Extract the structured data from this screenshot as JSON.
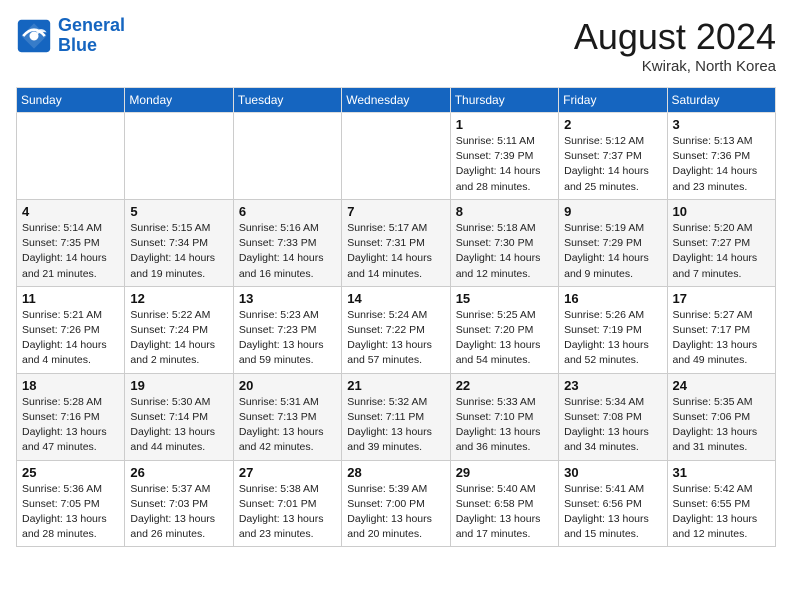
{
  "header": {
    "logo_line1": "General",
    "logo_line2": "Blue",
    "month_year": "August 2024",
    "location": "Kwirak, North Korea"
  },
  "weekdays": [
    "Sunday",
    "Monday",
    "Tuesday",
    "Wednesday",
    "Thursday",
    "Friday",
    "Saturday"
  ],
  "weeks": [
    [
      {
        "day": "",
        "detail": ""
      },
      {
        "day": "",
        "detail": ""
      },
      {
        "day": "",
        "detail": ""
      },
      {
        "day": "",
        "detail": ""
      },
      {
        "day": "1",
        "detail": "Sunrise: 5:11 AM\nSunset: 7:39 PM\nDaylight: 14 hours\nand 28 minutes."
      },
      {
        "day": "2",
        "detail": "Sunrise: 5:12 AM\nSunset: 7:37 PM\nDaylight: 14 hours\nand 25 minutes."
      },
      {
        "day": "3",
        "detail": "Sunrise: 5:13 AM\nSunset: 7:36 PM\nDaylight: 14 hours\nand 23 minutes."
      }
    ],
    [
      {
        "day": "4",
        "detail": "Sunrise: 5:14 AM\nSunset: 7:35 PM\nDaylight: 14 hours\nand 21 minutes."
      },
      {
        "day": "5",
        "detail": "Sunrise: 5:15 AM\nSunset: 7:34 PM\nDaylight: 14 hours\nand 19 minutes."
      },
      {
        "day": "6",
        "detail": "Sunrise: 5:16 AM\nSunset: 7:33 PM\nDaylight: 14 hours\nand 16 minutes."
      },
      {
        "day": "7",
        "detail": "Sunrise: 5:17 AM\nSunset: 7:31 PM\nDaylight: 14 hours\nand 14 minutes."
      },
      {
        "day": "8",
        "detail": "Sunrise: 5:18 AM\nSunset: 7:30 PM\nDaylight: 14 hours\nand 12 minutes."
      },
      {
        "day": "9",
        "detail": "Sunrise: 5:19 AM\nSunset: 7:29 PM\nDaylight: 14 hours\nand 9 minutes."
      },
      {
        "day": "10",
        "detail": "Sunrise: 5:20 AM\nSunset: 7:27 PM\nDaylight: 14 hours\nand 7 minutes."
      }
    ],
    [
      {
        "day": "11",
        "detail": "Sunrise: 5:21 AM\nSunset: 7:26 PM\nDaylight: 14 hours\nand 4 minutes."
      },
      {
        "day": "12",
        "detail": "Sunrise: 5:22 AM\nSunset: 7:24 PM\nDaylight: 14 hours\nand 2 minutes."
      },
      {
        "day": "13",
        "detail": "Sunrise: 5:23 AM\nSunset: 7:23 PM\nDaylight: 13 hours\nand 59 minutes."
      },
      {
        "day": "14",
        "detail": "Sunrise: 5:24 AM\nSunset: 7:22 PM\nDaylight: 13 hours\nand 57 minutes."
      },
      {
        "day": "15",
        "detail": "Sunrise: 5:25 AM\nSunset: 7:20 PM\nDaylight: 13 hours\nand 54 minutes."
      },
      {
        "day": "16",
        "detail": "Sunrise: 5:26 AM\nSunset: 7:19 PM\nDaylight: 13 hours\nand 52 minutes."
      },
      {
        "day": "17",
        "detail": "Sunrise: 5:27 AM\nSunset: 7:17 PM\nDaylight: 13 hours\nand 49 minutes."
      }
    ],
    [
      {
        "day": "18",
        "detail": "Sunrise: 5:28 AM\nSunset: 7:16 PM\nDaylight: 13 hours\nand 47 minutes."
      },
      {
        "day": "19",
        "detail": "Sunrise: 5:30 AM\nSunset: 7:14 PM\nDaylight: 13 hours\nand 44 minutes."
      },
      {
        "day": "20",
        "detail": "Sunrise: 5:31 AM\nSunset: 7:13 PM\nDaylight: 13 hours\nand 42 minutes."
      },
      {
        "day": "21",
        "detail": "Sunrise: 5:32 AM\nSunset: 7:11 PM\nDaylight: 13 hours\nand 39 minutes."
      },
      {
        "day": "22",
        "detail": "Sunrise: 5:33 AM\nSunset: 7:10 PM\nDaylight: 13 hours\nand 36 minutes."
      },
      {
        "day": "23",
        "detail": "Sunrise: 5:34 AM\nSunset: 7:08 PM\nDaylight: 13 hours\nand 34 minutes."
      },
      {
        "day": "24",
        "detail": "Sunrise: 5:35 AM\nSunset: 7:06 PM\nDaylight: 13 hours\nand 31 minutes."
      }
    ],
    [
      {
        "day": "25",
        "detail": "Sunrise: 5:36 AM\nSunset: 7:05 PM\nDaylight: 13 hours\nand 28 minutes."
      },
      {
        "day": "26",
        "detail": "Sunrise: 5:37 AM\nSunset: 7:03 PM\nDaylight: 13 hours\nand 26 minutes."
      },
      {
        "day": "27",
        "detail": "Sunrise: 5:38 AM\nSunset: 7:01 PM\nDaylight: 13 hours\nand 23 minutes."
      },
      {
        "day": "28",
        "detail": "Sunrise: 5:39 AM\nSunset: 7:00 PM\nDaylight: 13 hours\nand 20 minutes."
      },
      {
        "day": "29",
        "detail": "Sunrise: 5:40 AM\nSunset: 6:58 PM\nDaylight: 13 hours\nand 17 minutes."
      },
      {
        "day": "30",
        "detail": "Sunrise: 5:41 AM\nSunset: 6:56 PM\nDaylight: 13 hours\nand 15 minutes."
      },
      {
        "day": "31",
        "detail": "Sunrise: 5:42 AM\nSunset: 6:55 PM\nDaylight: 13 hours\nand 12 minutes."
      }
    ]
  ]
}
